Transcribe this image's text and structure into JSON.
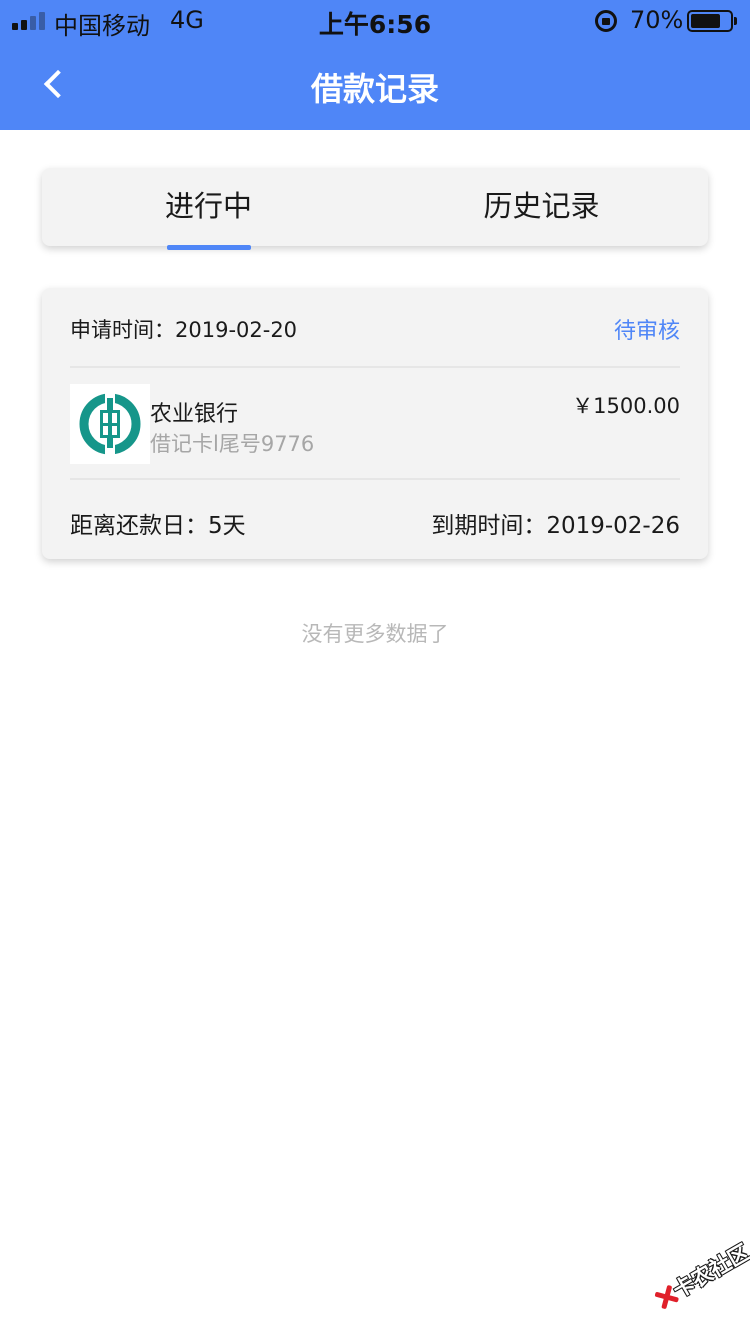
{
  "status_bar": {
    "carrier": "中国移动",
    "network": "4G",
    "time": "上午6:56",
    "battery": "70%",
    "battery_level": 0.7
  },
  "nav": {
    "title": "借款记录",
    "back_icon": "chevron-left-icon"
  },
  "tabs": [
    {
      "label": "进行中",
      "active": true
    },
    {
      "label": "历史记录",
      "active": false
    }
  ],
  "record": {
    "apply_time_label": "申请时间：",
    "apply_time": "2019-02-20",
    "status": "待审核",
    "bank_logo_icon": "abc-bank-logo-icon",
    "bank_name": "农业银行",
    "card_desc": "借记卡l尾号9776",
    "amount": "￥1500.00",
    "countdown_label": "距离还款日：",
    "countdown_value": "5天",
    "due_label": "到期时间：",
    "due_date": "2019-02-26"
  },
  "footer_text": "没有更多数据了",
  "watermark": "卡农社区",
  "colors": {
    "header": "#4f86f7",
    "accent": "#4f86f7",
    "card_bg": "#f3f3f3",
    "bank_logo": "#16968a",
    "watermark_red": "#e0202a"
  }
}
